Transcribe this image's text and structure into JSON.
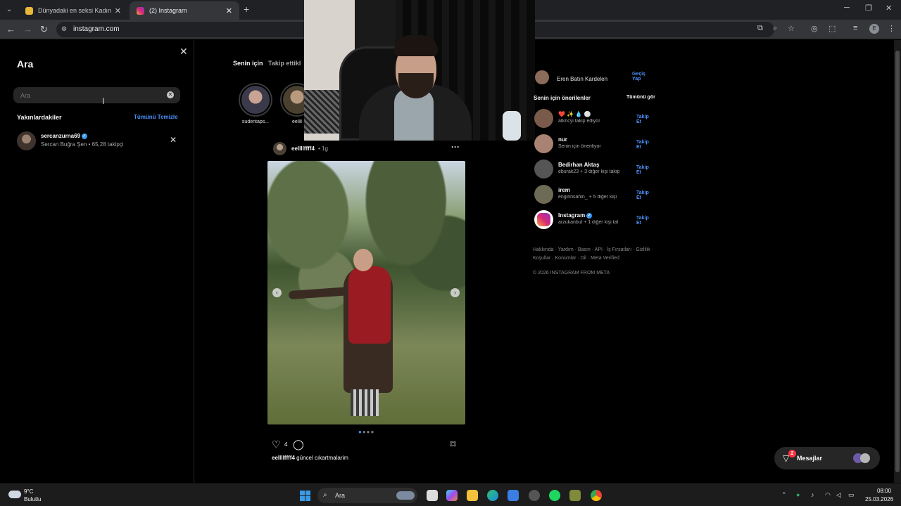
{
  "browser": {
    "tabs": [
      {
        "title": "Dünyadaki en seksi Kadın kim -",
        "active": false
      },
      {
        "title": "(2) Instagram",
        "active": true
      }
    ],
    "url": "instagram.com",
    "profile_initial": "E"
  },
  "search": {
    "title": "Ara",
    "placeholder": "Ara",
    "recent_title": "Yakınlardakiler",
    "clear_all": "Tümünü Temizle",
    "recent": [
      {
        "username": "sercanzurna69",
        "verified": true,
        "subtitle": "Sercan Buğra Şen • 65,28 takipçi"
      }
    ]
  },
  "feed": {
    "tabs": [
      "Senin için",
      "Takip ettikl"
    ],
    "stories": [
      {
        "name": "sudentaps..."
      },
      {
        "name": "eellll"
      }
    ],
    "post": {
      "username": "eellllffff4",
      "time": "• 1g",
      "likes": "4",
      "caption_user": "eellllffff4",
      "caption_text": "güncel cıkartmalarim"
    }
  },
  "sidebar": {
    "current_user": "Eren Batın Kardelen",
    "switch_label": "Geçiş Yap",
    "suggestions_title": "Senin için önerilenler",
    "see_all": "Tümünü gör",
    "suggestions": [
      {
        "name": "❤️ ✨ 💧 ⚪",
        "sub": "atkncyi takip ediyor",
        "follow": "Takip Et",
        "color": "#7a5a4a"
      },
      {
        "name": "nur",
        "sub": "Senin için öneriliyor",
        "follow": "Takip Et",
        "color": "#a88272"
      },
      {
        "name": "Bedirhan Aktaş",
        "sub": "eburak23 + 3 diğer kişi takip",
        "follow": "Takip Et",
        "color": "#555555"
      },
      {
        "name": "irem",
        "sub": "enginnsahin_ + 5 diğer kişi",
        "follow": "Takip Et",
        "color": "#6d6a55"
      },
      {
        "name": "Instagram",
        "sub": "arzukanbul + 1 diğer kişi tal",
        "follow": "Takip Et",
        "color": "#ffffff"
      }
    ],
    "footer_line1": "Hakkında · Yardım · Basın · API · İş Fırsatları · Gizlilik ·",
    "footer_line2": "Koşullar · Konumlar · Dil · Meta Verified",
    "copyright": "© 2026 INSTAGRAM FROM META"
  },
  "messages": {
    "label": "Mesajlar",
    "badge": "2"
  },
  "taskbar": {
    "temp": "9°C",
    "condition": "Bulutlu",
    "search_label": "Ara",
    "time": "08:00",
    "date": "25.03.2026"
  }
}
